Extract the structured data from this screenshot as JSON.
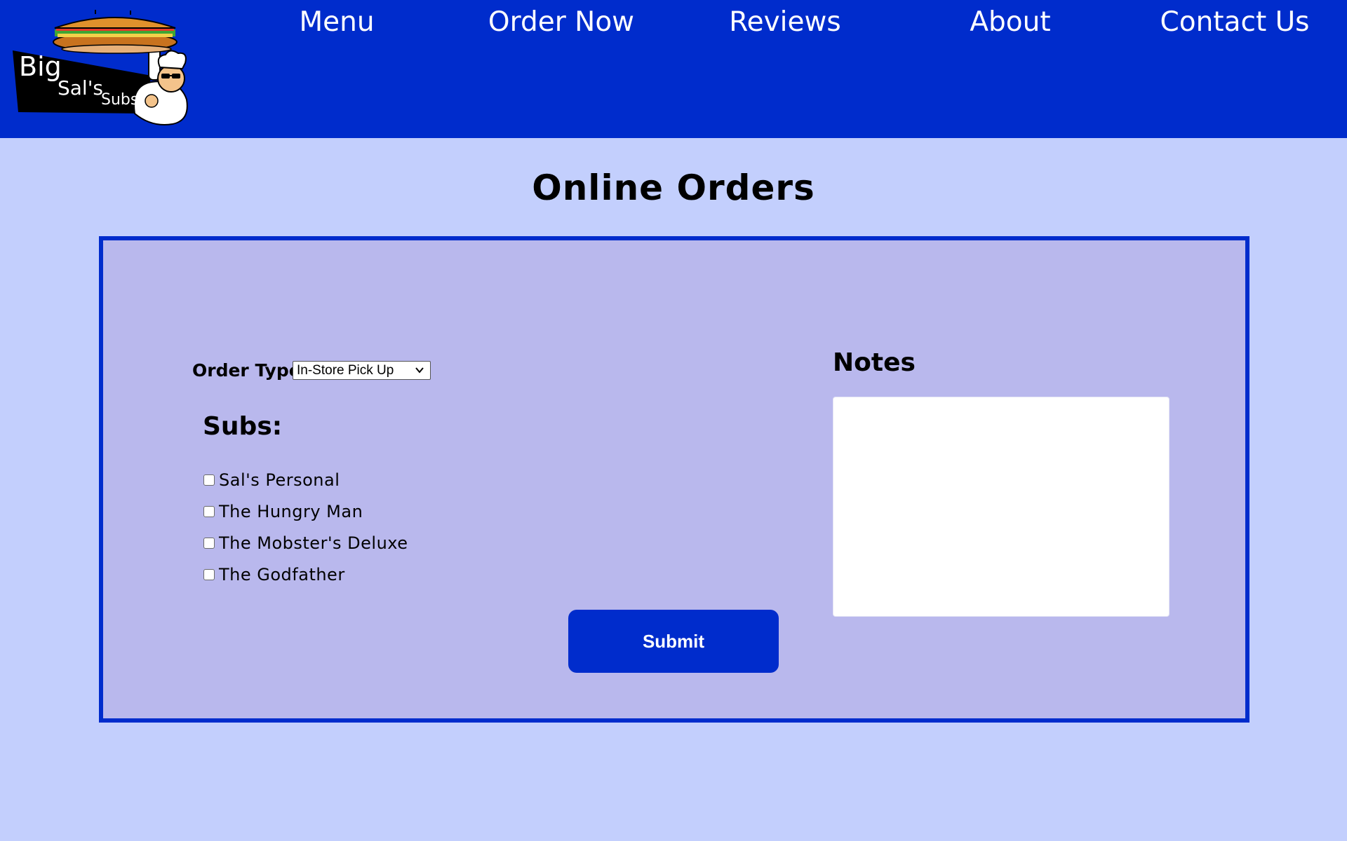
{
  "header": {
    "logo": {
      "line1": "Big",
      "line2": "Sal's",
      "line3": "Subs"
    },
    "nav": [
      {
        "label": "Menu"
      },
      {
        "label": "Order Now"
      },
      {
        "label": "Reviews"
      },
      {
        "label": "About"
      },
      {
        "label": "Contact Us"
      }
    ],
    "colors": {
      "header_bg": "#002ccc",
      "page_bg": "#c3cffd",
      "panel_bg": "#b9b8ed"
    }
  },
  "main": {
    "title": "Online Orders",
    "order_type": {
      "label": "Order Type",
      "selected": "In-Store Pick Up"
    },
    "subs": {
      "heading": "Subs:",
      "options": [
        {
          "label": "Sal's Personal",
          "checked": false
        },
        {
          "label": "The Hungry Man",
          "checked": false
        },
        {
          "label": "The Mobster's Deluxe",
          "checked": false
        },
        {
          "label": "The Godfather",
          "checked": false
        }
      ]
    },
    "notes": {
      "heading": "Notes",
      "value": ""
    },
    "submit_label": "Submit"
  }
}
